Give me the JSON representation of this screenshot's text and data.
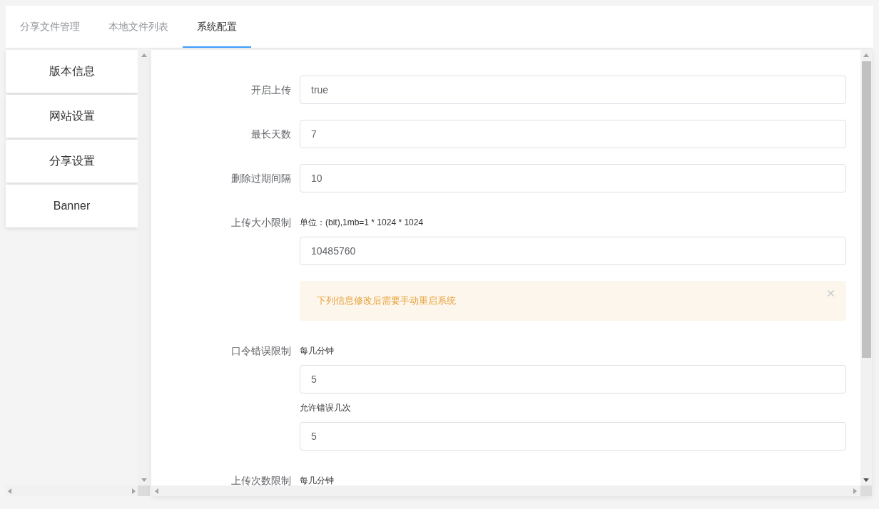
{
  "tabs": [
    {
      "label": "分享文件管理",
      "selected": false
    },
    {
      "label": "本地文件列表",
      "selected": false
    },
    {
      "label": "系统配置",
      "selected": true
    }
  ],
  "sidebar": {
    "items": [
      {
        "label": "版本信息"
      },
      {
        "label": "网站设置"
      },
      {
        "label": "分享设置"
      },
      {
        "label": "Banner"
      }
    ]
  },
  "form": {
    "rows": [
      {
        "kind": "field",
        "label": "开启上传",
        "entries": [
          {
            "value": "true"
          }
        ]
      },
      {
        "kind": "field",
        "label": "最长天数",
        "entries": [
          {
            "value": "7"
          }
        ]
      },
      {
        "kind": "field",
        "label": "删除过期间隔",
        "entries": [
          {
            "value": "10"
          }
        ]
      },
      {
        "kind": "field",
        "label": "上传大小限制",
        "entries": [
          {
            "hint": "单位：(bit),1mb=1 * 1024 * 1024"
          },
          {
            "value": "10485760"
          }
        ]
      },
      {
        "kind": "alert",
        "text": "下列信息修改后需要手动重启系统",
        "closable": true
      },
      {
        "kind": "field",
        "label": "口令错误限制",
        "entries": [
          {
            "hint": "每几分钟"
          },
          {
            "value": "5"
          },
          {
            "hint": "允许错误几次"
          },
          {
            "value": "5"
          }
        ]
      },
      {
        "kind": "field",
        "label": "上传次数限制",
        "entries": [
          {
            "hint": "每几分钟"
          }
        ]
      }
    ]
  }
}
